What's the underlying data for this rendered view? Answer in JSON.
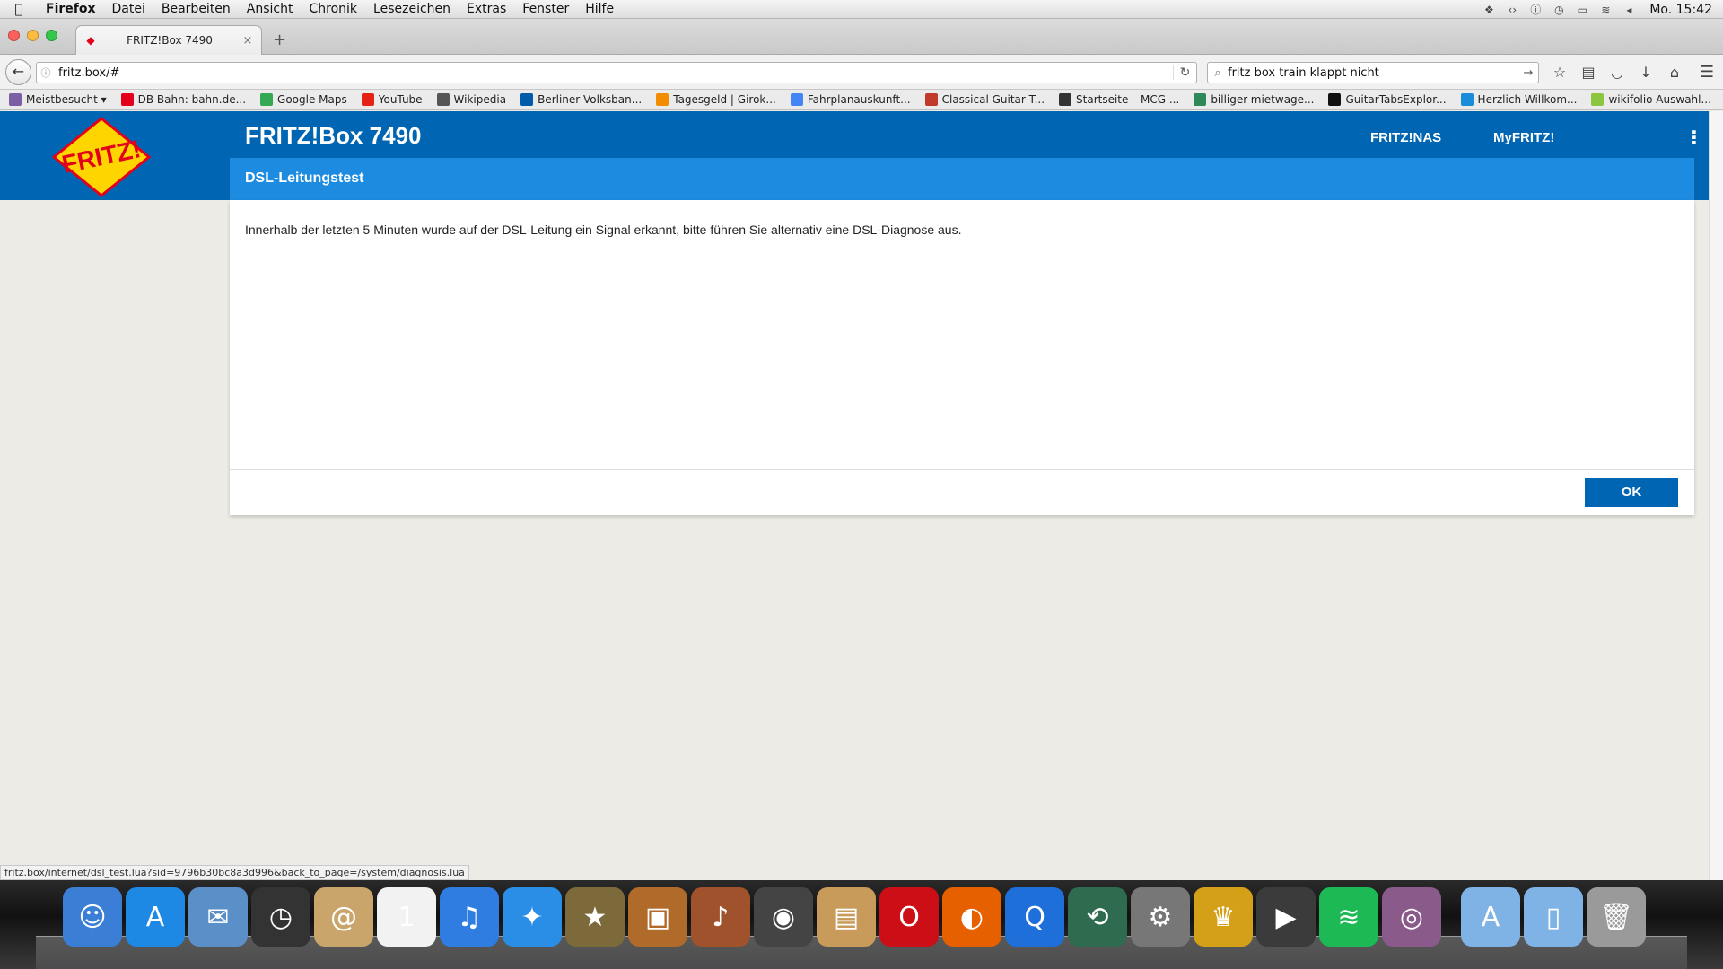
{
  "menubar": {
    "apple_icon": "apple-icon",
    "items": [
      "Firefox",
      "Datei",
      "Bearbeiten",
      "Ansicht",
      "Chronik",
      "Lesezeichen",
      "Extras",
      "Fenster",
      "Hilfe"
    ],
    "clock": "Mo. 15:42"
  },
  "tab": {
    "title": "FRITZ!Box 7490",
    "close": "×"
  },
  "newtab": "+",
  "nav": {
    "url": "fritz.box/#",
    "search": "fritz box train klappt nicht"
  },
  "bookmarks": [
    {
      "label": "Meistbesucht ▾",
      "color": "#7a5fa5"
    },
    {
      "label": "DB Bahn: bahn.de...",
      "color": "#e2001a"
    },
    {
      "label": "Google Maps",
      "color": "#34a853"
    },
    {
      "label": "YouTube",
      "color": "#e62117"
    },
    {
      "label": "Wikipedia",
      "color": "#555555"
    },
    {
      "label": "Berliner Volksban...",
      "color": "#005ca9"
    },
    {
      "label": "Tagesgeld | Girok...",
      "color": "#f28c00"
    },
    {
      "label": "Fahrplanauskunft...",
      "color": "#4285f4"
    },
    {
      "label": "Classical Guitar T...",
      "color": "#c0392b"
    },
    {
      "label": "Startseite – MCG ...",
      "color": "#333333"
    },
    {
      "label": "billiger-mietwage...",
      "color": "#2e8b57"
    },
    {
      "label": "GuitarTabsExplor...",
      "color": "#111111"
    },
    {
      "label": "Herzlich Willkom...",
      "color": "#1a8cd8"
    },
    {
      "label": "wikifolio Auswahl...",
      "color": "#8cc63f"
    }
  ],
  "fritz": {
    "logo_text": "FRITZ!",
    "product": "FRITZ!Box 7490",
    "links": [
      "FRITZ!NAS",
      "MyFRITZ!"
    ],
    "page_title": "DSL-Leitungstest",
    "message": "Innerhalb der letzten 5 Minuten wurde auf der DSL-Leitung ein Signal erkannt, bitte führen Sie alternativ eine DSL-Diagnose aus.",
    "ok_label": "OK",
    "brand_color": "#0066b3",
    "accent_color": "#1c8be0"
  },
  "status_link": "fritz.box/internet/dsl_test.lua?sid=9796b30bc8a3d996&back_to_page=/system/diagnosis.lua",
  "dock": [
    {
      "name": "finder-icon",
      "glyph": "☺",
      "bg": "#3a7fd5"
    },
    {
      "name": "app-store-icon",
      "glyph": "A",
      "bg": "#1e88e5"
    },
    {
      "name": "mail-icon",
      "glyph": "✉",
      "bg": "#5b8fc7"
    },
    {
      "name": "dashboard-icon",
      "glyph": "◷",
      "bg": "#333333"
    },
    {
      "name": "contacts-icon",
      "glyph": "@",
      "bg": "#c9a46b"
    },
    {
      "name": "calendar-icon",
      "glyph": "1",
      "bg": "#f2f2f2"
    },
    {
      "name": "itunes-icon",
      "glyph": "♫",
      "bg": "#2f7de1"
    },
    {
      "name": "safari-icon",
      "glyph": "✦",
      "bg": "#2a8ee6"
    },
    {
      "name": "imovie-icon",
      "glyph": "★",
      "bg": "#7d6a3a"
    },
    {
      "name": "iphoto-icon",
      "glyph": "▣",
      "bg": "#b06a2a"
    },
    {
      "name": "garageband-icon",
      "glyph": "♪",
      "bg": "#a0522d"
    },
    {
      "name": "dvd-player-icon",
      "glyph": "◉",
      "bg": "#444444"
    },
    {
      "name": "preview-icon",
      "glyph": "▤",
      "bg": "#c99b5b"
    },
    {
      "name": "opera-icon",
      "glyph": "O",
      "bg": "#cc0f16"
    },
    {
      "name": "firefox-icon",
      "glyph": "◐",
      "bg": "#e66000"
    },
    {
      "name": "quicktime-icon",
      "glyph": "Q",
      "bg": "#1e6fd9"
    },
    {
      "name": "time-machine-icon",
      "glyph": "⟲",
      "bg": "#2e6b4f"
    },
    {
      "name": "system-preferences-icon",
      "glyph": "⚙",
      "bg": "#777777"
    },
    {
      "name": "game-icon",
      "glyph": "♛",
      "bg": "#d4a017"
    },
    {
      "name": "facetime-icon",
      "glyph": "▶",
      "bg": "#3b3b3b"
    },
    {
      "name": "spotify-icon",
      "glyph": "≋",
      "bg": "#1db954"
    },
    {
      "name": "photo-booth-icon",
      "glyph": "◎",
      "bg": "#8a5a8a"
    }
  ],
  "dock_right": [
    {
      "name": "applications-folder-icon",
      "glyph": "A",
      "bg": "#7fb2e5"
    },
    {
      "name": "documents-folder-icon",
      "glyph": "▯",
      "bg": "#7fb2e5"
    },
    {
      "name": "trash-icon",
      "glyph": "🗑",
      "bg": "#9a9a9a"
    }
  ]
}
